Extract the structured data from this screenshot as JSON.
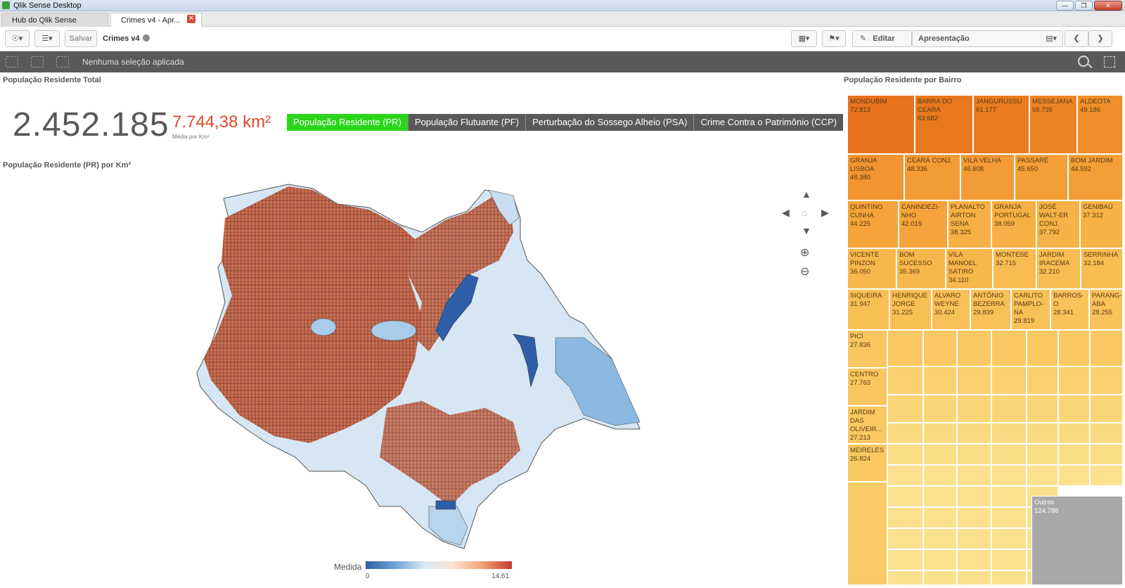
{
  "window": {
    "title": "Qlik Sense Desktop"
  },
  "tabs": [
    {
      "label": "Hub do Qlik Sense Desktop"
    },
    {
      "label": "Crimes v4 - Apr..."
    }
  ],
  "toolbar": {
    "save_label": "Salvar",
    "app_name": "Crimes v4",
    "edit_label": "Editar",
    "presentation_label": "Apresentação"
  },
  "selections": {
    "text": "Nenhuma seleção aplicada"
  },
  "kpi": {
    "title": "População Residente Total",
    "value": "2.452.185",
    "area": "7.744,38 km²",
    "subtitle": "Média por Km²"
  },
  "buttons": [
    {
      "label": "População Residente (PR)",
      "active": true
    },
    {
      "label": "População Flutuante (PF)",
      "active": false
    },
    {
      "label": "Perturbação do Sossego Alheio (PSA)",
      "active": false
    },
    {
      "label": "Crime Contra o Patrimônio (CCP)",
      "active": false
    }
  ],
  "map": {
    "title": "População Residente (PR) por Km²",
    "legend_title": "Medida",
    "legend_min": "0",
    "legend_max": "14.61"
  },
  "treemap": {
    "title": "População Residente por Bairro",
    "items": [
      {
        "name": "MONDUBIM",
        "value": "72.813",
        "color": "#e8731f"
      },
      {
        "name": "BARRA DO CEARA",
        "value": "63.682",
        "color": "#e8781f"
      },
      {
        "name": "JANGURUSSU",
        "value": "61.177",
        "color": "#e97c20"
      },
      {
        "name": "MESSEJANA",
        "value": "58.735",
        "color": "#ec8426"
      },
      {
        "name": "ALDEOTA",
        "value": "49.186",
        "color": "#ef8e2b"
      },
      {
        "name": "GRANJA LISBOA",
        "value": "48.380",
        "color": "#f19431"
      },
      {
        "name": "CEARÁ CONJ.",
        "value": "48.336",
        "color": "#f29a35"
      },
      {
        "name": "VILA VELHA",
        "value": "46.608",
        "color": "#f29a35"
      },
      {
        "name": "PASSARÉ",
        "value": "45.650",
        "color": "#f39f37"
      },
      {
        "name": "BOM JARDIM",
        "value": "44.592",
        "color": "#f39f37"
      },
      {
        "name": "QUINTINO CUNHA",
        "value": "44.225",
        "color": "#f4a43a"
      },
      {
        "name": "CANINDEZI-NHO",
        "value": "42.015",
        "color": "#f4a43a"
      },
      {
        "name": "PLANALTO AIRTON SENA",
        "value": "38.325",
        "color": "#f6b045"
      },
      {
        "name": "GRANJA PORTUGAL",
        "value": "38.059",
        "color": "#f6b045"
      },
      {
        "name": "JOSÉ WALT-ER CONJ.",
        "value": "37.792",
        "color": "#f6b246"
      },
      {
        "name": "GENIBAÚ",
        "value": "37.312",
        "color": "#f6b246"
      },
      {
        "name": "VICENTE PINZON",
        "value": "36.050",
        "color": "#f7b74c"
      },
      {
        "name": "BOM SUCESSO",
        "value": "35.369",
        "color": "#f7b74c"
      },
      {
        "name": "VILA MANOEL SÁTIRO",
        "value": "34.110",
        "color": "#f7b74c"
      },
      {
        "name": "MONTESE",
        "value": "32.715",
        "color": "#f8bc52"
      },
      {
        "name": "JARDIM IRACEMA",
        "value": "32.210",
        "color": "#f8bc52"
      },
      {
        "name": "SERRINHA",
        "value": "32.184",
        "color": "#f8bc52"
      },
      {
        "name": "SIQUEIRA",
        "value": "31.947",
        "color": "#f8bf55"
      },
      {
        "name": "HENRIQUE JORGE",
        "value": "31.225",
        "color": "#f8bf55"
      },
      {
        "name": "ALVARO WEYNE",
        "value": "30.424",
        "color": "#f8c058"
      },
      {
        "name": "ANTÔNIO BEZERRA",
        "value": "29.839",
        "color": "#f8c058"
      },
      {
        "name": "CARLITO PAMPLO-NA",
        "value": "29.819",
        "color": "#f8c058"
      },
      {
        "name": "BARROS-O",
        "value": "28.341",
        "color": "#f9c35c"
      },
      {
        "name": "PARANG-ABA",
        "value": "28.255",
        "color": "#f9c35c"
      },
      {
        "name": "PICÍ",
        "value": "27.836",
        "color": "#f9c65f"
      },
      {
        "name": "CENTRO",
        "value": "27.763",
        "color": "#f9c65f"
      },
      {
        "name": "JARDIM DAS OLIVEIR...",
        "value": "27.213",
        "color": "#f9c862"
      },
      {
        "name": "MEIRELES",
        "value": "26.824",
        "color": "#f9c862"
      },
      {
        "name": "Outros",
        "value": "124.788",
        "color": "#a8a8a8"
      }
    ]
  }
}
